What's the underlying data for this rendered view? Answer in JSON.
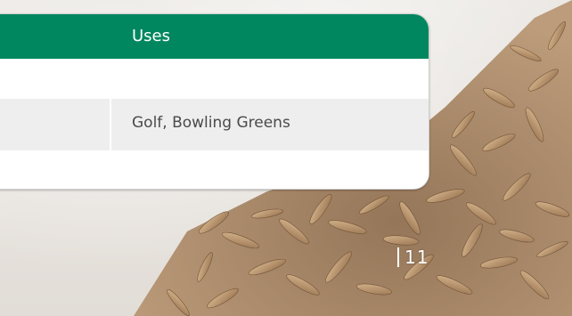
{
  "table": {
    "header": {
      "uses_label": "Uses"
    },
    "rows": [
      {
        "uses": ""
      },
      {
        "uses": "Golf, Bowling Greens"
      },
      {
        "uses": ""
      }
    ]
  },
  "footer": {
    "page_number": "11"
  },
  "colors": {
    "header_green": "#00875f",
    "row_alt": "#eeeeee",
    "text": "#4a4a4a"
  },
  "background": {
    "image_icon": "grass-seed-pile"
  }
}
